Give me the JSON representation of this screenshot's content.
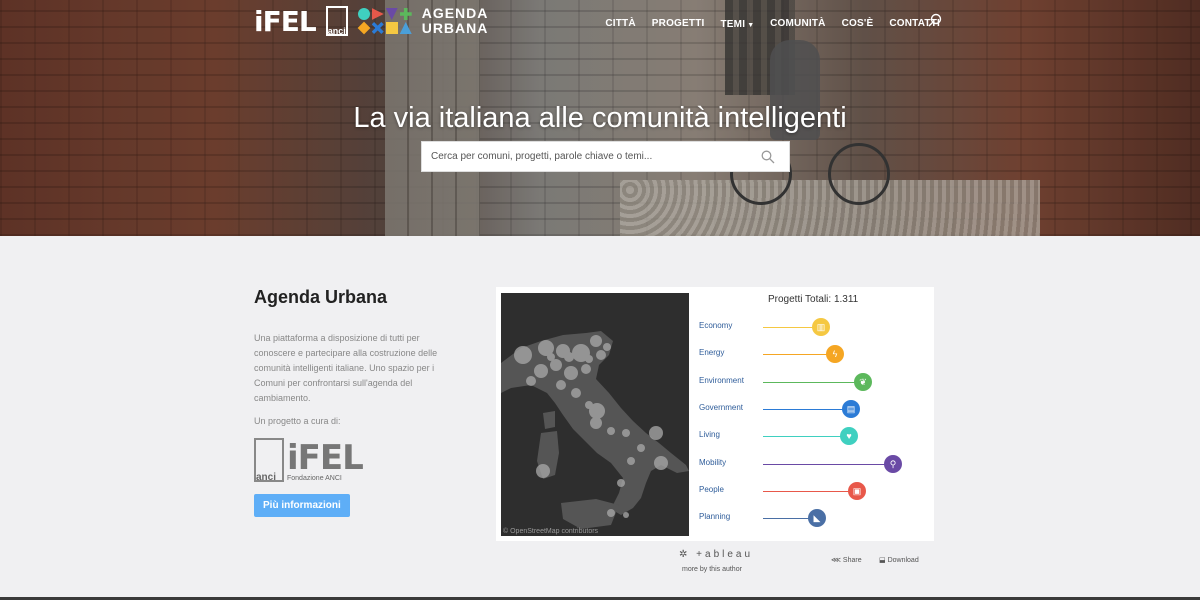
{
  "header": {
    "logo_ifel": "iFEL",
    "logo_anci": "anci",
    "logo_agenda_urbana": [
      "AGENDA",
      "URBANA"
    ],
    "nav": [
      {
        "label": "CITTÀ"
      },
      {
        "label": "PROGETTI"
      },
      {
        "label": "TEMI",
        "has_dropdown": true
      },
      {
        "label": "COMUNITÀ"
      },
      {
        "label": "COS'È"
      },
      {
        "label": "CONTATTI"
      }
    ],
    "search_icon": "search-icon"
  },
  "hero": {
    "title": "La via italiana alle comunità intelligenti",
    "search_placeholder": "Cerca per comuni, progetti, parole chiave o temi..."
  },
  "about": {
    "title": "Agenda Urbana",
    "description": "Una piattaforma a disposizione di tutti per conoscere e partecipare alla costruzione delle comunità intelligenti italiane. Uno spazio per i Comuni per confrontarsi sull'agenda del cambiamento.",
    "credit": "Un progetto a cura di:",
    "logo_ifel": "iFEL",
    "logo_anci": "anci",
    "logo_subtitle": "Fondazione ANCI",
    "button": "Più informazioni"
  },
  "viz": {
    "total": "Progetti Totali: 1.311",
    "map_attribution": "© OpenStreetMap contributors",
    "themes": [
      {
        "label": "Economy",
        "color": "#f5c842",
        "icon": "chart-icon",
        "level": 0.29
      },
      {
        "label": "Energy",
        "color": "#f5a623",
        "icon": "lightning-icon",
        "level": 0.36
      },
      {
        "label": "Environment",
        "color": "#5cb85c",
        "icon": "leaf-icon",
        "level": 0.5
      },
      {
        "label": "Government",
        "color": "#2b7bd6",
        "icon": "document-icon",
        "level": 0.44
      },
      {
        "label": "Living",
        "color": "#3fd0c0",
        "icon": "heart-icon",
        "level": 0.43
      },
      {
        "label": "Mobility",
        "color": "#6a4aa5",
        "icon": "bike-icon",
        "level": 0.65
      },
      {
        "label": "People",
        "color": "#e8584a",
        "icon": "gift-icon",
        "level": 0.47
      },
      {
        "label": "Planning",
        "color": "#4a6fa5",
        "icon": "ruler-icon",
        "level": 0.27
      }
    ]
  },
  "tableau": {
    "logo": "+ableau",
    "more": "more by this author",
    "share": "Share",
    "download": "Download"
  }
}
